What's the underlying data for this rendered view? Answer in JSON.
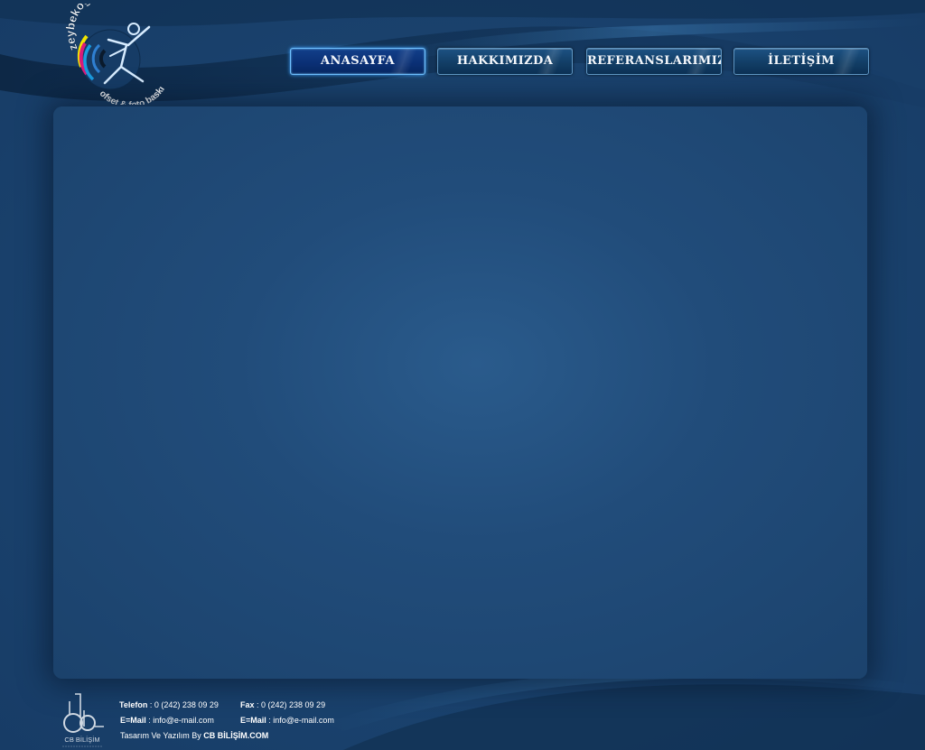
{
  "logo": {
    "brand_name": "zeybekoğlu",
    "tagline": "ofset & foto baskı"
  },
  "nav": {
    "items": [
      {
        "label": "ANASAYFA",
        "active": true
      },
      {
        "label": "HAKKIMIZDA",
        "active": false
      },
      {
        "label": "REFERANSLARIMIZ",
        "active": false
      },
      {
        "label": "İLETİŞİM",
        "active": false
      }
    ]
  },
  "footer": {
    "phone_label": "Telefon",
    "phone_value": " : 0 (242) 238 09 29",
    "fax_label": "Fax",
    "fax_value": " : 0 (242) 238 09 29",
    "email_label_1": "E=Mail",
    "email_value_1": " : info@e-mail.com",
    "email_label_2": "E=Mail",
    "email_value_2": " : info@e-mail.com",
    "credit_prefix": "Tasarım Ve Yazılım By ",
    "credit_brand": "CB BİLİŞİM.COM",
    "cb_logo_text": "CB BİLİŞİM"
  },
  "colors": {
    "background": "#1b4470",
    "nav_active_border": "#6fc0ff",
    "nav_border": "#5f97c4",
    "logo_blue": "#2f7fd1",
    "logo_magenta": "#d81b7a",
    "logo_yellow": "#f3e600"
  }
}
